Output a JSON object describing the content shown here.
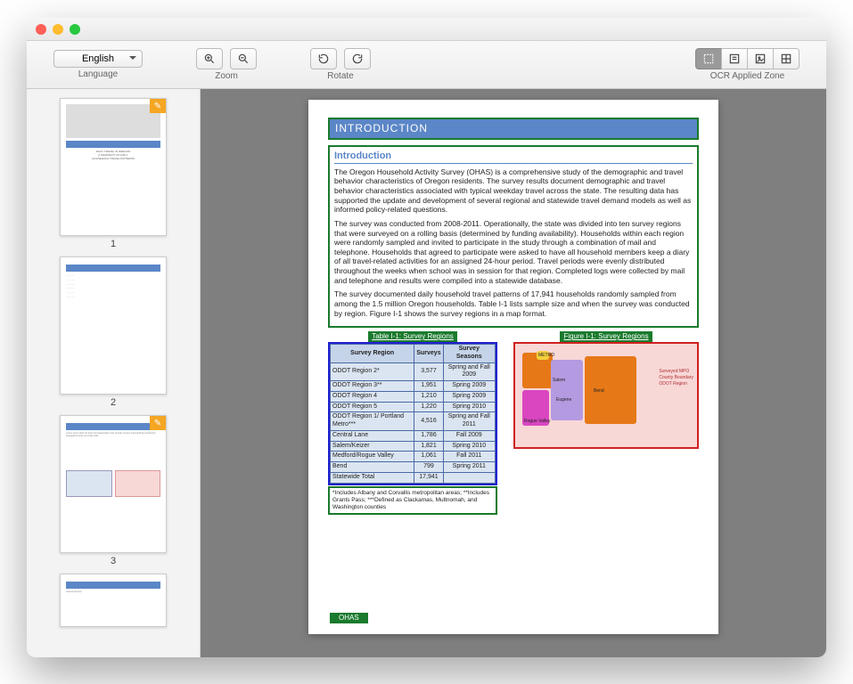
{
  "toolbar": {
    "language": {
      "selected": "English",
      "label": "Language"
    },
    "zoom": {
      "label": "Zoom",
      "in_icon": "zoom-in-icon",
      "out_icon": "zoom-out-icon"
    },
    "rotate": {
      "label": "Rotate",
      "ccw_icon": "rotate-ccw-icon",
      "cw_icon": "rotate-cw-icon"
    },
    "ocr": {
      "label": "OCR Applied Zone",
      "buttons": [
        "zone-select-icon",
        "zone-text-icon",
        "zone-image-icon",
        "zone-table-icon"
      ]
    }
  },
  "thumbnails": [
    {
      "num": "1",
      "has_badge": true
    },
    {
      "num": "2",
      "has_badge": false
    },
    {
      "num": "3",
      "has_badge": true
    },
    {
      "num": "",
      "has_badge": false
    }
  ],
  "page": {
    "header": "INTRODUCTION",
    "section_title": "Introduction",
    "paras": [
      "The Oregon Household Activity Survey (OHAS) is a comprehensive study of the demographic and travel behavior characteristics of Oregon residents. The survey results document demographic and travel behavior characteristics associated with typical weekday travel across the state. The resulting data has supported the update and development of several regional and statewide travel demand models as well as informed policy-related questions.",
      "The survey was conducted from 2008-2011. Operationally, the state was divided into ten survey regions that were surveyed on a rolling basis (determined by funding availability). Households within each region were randomly sampled and invited to participate in the study through a combination of mail and telephone. Households that agreed to participate were asked to have all household members keep a diary of all travel-related activities for an assigned 24-hour period. Travel periods were evenly distributed throughout the weeks when school was in session for that region. Completed logs were collected by mail and telephone and results were compiled into a statewide database.",
      "The survey documented daily household travel patterns of 17,941 households randomly sampled from among the 1.5 million Oregon households. Table I-1 lists sample size and when the survey was conducted by region. Figure I-1 shows the survey regions in a map format."
    ],
    "table_caption": "Table I-1:  Survey Regions",
    "figure_caption": "Figure I-1:  Survey Regions",
    "table_headers": [
      "Survey Region",
      "Surveys",
      "Survey Seasons"
    ],
    "table_rows": [
      [
        "ODOT Region 2*",
        "3,577",
        "Spring and Fall 2009"
      ],
      [
        "ODOT Region 3**",
        "1,951",
        "Spring 2009"
      ],
      [
        "ODOT Region 4",
        "1,210",
        "Spring 2009"
      ],
      [
        "ODOT Region 5",
        "1,220",
        "Spring 2010"
      ],
      [
        "ODOT Region 1/ Portland Metro***",
        "4,516",
        "Spring and Fall 2011"
      ],
      [
        "Central Lane",
        "1,786",
        "Fall 2009"
      ],
      [
        "Salem/Keizer",
        "1,821",
        "Spring 2010"
      ],
      [
        "Medford/Rogue Valley",
        "1,061",
        "Fall 2011"
      ],
      [
        "Bend",
        "799",
        "Spring 2011"
      ],
      [
        "Statewide Total",
        "17,941",
        ""
      ]
    ],
    "table_note": "*Includes Albany and Corvallis metropolitan areas; **Includes Grants Pass; ***Defined as Clackamas, Multnomah, and Washington counties",
    "map_legend": [
      "Surveyed MPO",
      "County Boundary",
      "ODOT Region"
    ],
    "map_labels": [
      "METRO",
      "Salem",
      "Eugene",
      "Rogue Valley",
      "Bend"
    ],
    "page_number": "OHAS"
  }
}
